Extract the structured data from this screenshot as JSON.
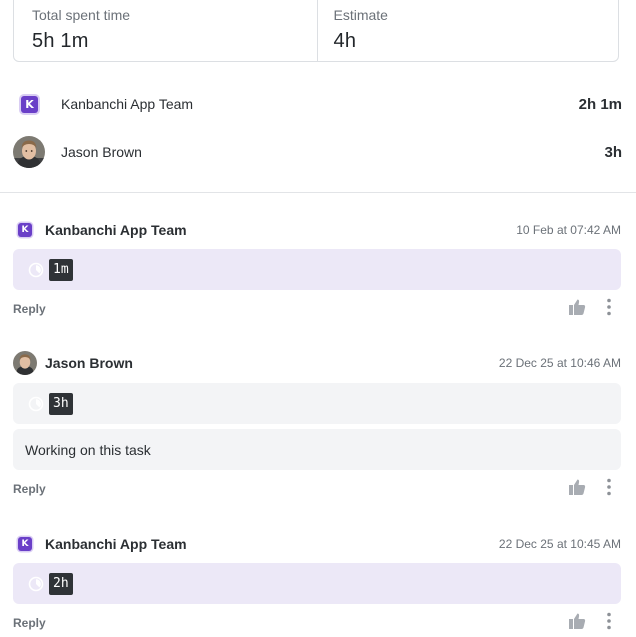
{
  "summary": {
    "total_label": "Total spent time",
    "total_value": "5h 1m",
    "estimate_label": "Estimate",
    "estimate_value": "4h"
  },
  "members": [
    {
      "name": "Kanbanchi App Team",
      "time": "2h 1m",
      "avatar": "kanbanchi-logo-icon"
    },
    {
      "name": "Jason Brown",
      "time": "3h",
      "avatar": "user-photo"
    }
  ],
  "comments": [
    {
      "author": "Kanbanchi App Team",
      "date": "10 Feb at 07:42 AM",
      "time_tag": "1m",
      "text": "",
      "reply": "Reply"
    },
    {
      "author": "Jason Brown",
      "date": "22 Dec 25 at 10:46 AM",
      "time_tag": "3h",
      "text": "Working on this task",
      "reply": "Reply"
    },
    {
      "author": "Kanbanchi App Team",
      "date": "22 Dec 25 at 10:45 AM",
      "time_tag": "2h",
      "text": "",
      "reply": "Reply"
    }
  ],
  "colors": {
    "brand": "#6a3fc8",
    "team_bubble": "#ece8f7",
    "user_bubble": "#f3f4f6",
    "time_tag_bg": "#2f3337"
  }
}
